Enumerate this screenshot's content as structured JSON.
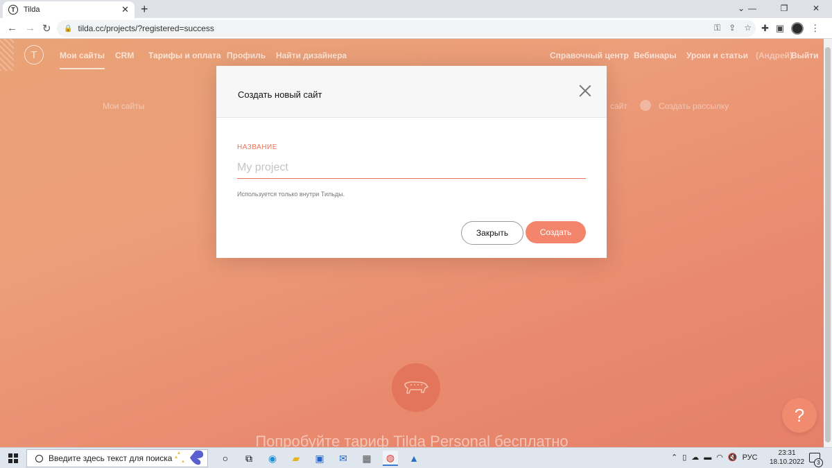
{
  "browser": {
    "tab_title": "Tilda",
    "tab_favicon": "tilda-logo-icon",
    "url": "tilda.cc/projects/?registered=success"
  },
  "site": {
    "logo": "T",
    "nav_left": [
      "Мои сайты",
      "CRM",
      "Тарифы и оплата",
      "Профиль",
      "Найти дизайнера"
    ],
    "nav_right": [
      "Справочный центр",
      "Вебинары",
      "Уроки и статьи",
      "(Андрей)",
      "Выйти"
    ],
    "subnav_left": "Мои сайты",
    "subnav_right_1": "сайт",
    "subnav_right_2": "Создать рассылку",
    "promo_text": "Попробуйте тариф Tilda Personal бесплатно",
    "help_label": "?",
    "accent_color": "#f3856c"
  },
  "modal": {
    "title": "Создать новый сайт",
    "field_label": "НАЗВАНИЕ",
    "field_placeholder": "My project",
    "field_value": "",
    "hint": "Используется только внутри Тильды.",
    "close_label": "Закрыть",
    "create_label": "Создать"
  },
  "taskbar": {
    "search_placeholder": "Введите здесь текст для поиска",
    "language": "РУС",
    "time": "23:31",
    "date": "18.10.2022",
    "notification_count": "3"
  }
}
